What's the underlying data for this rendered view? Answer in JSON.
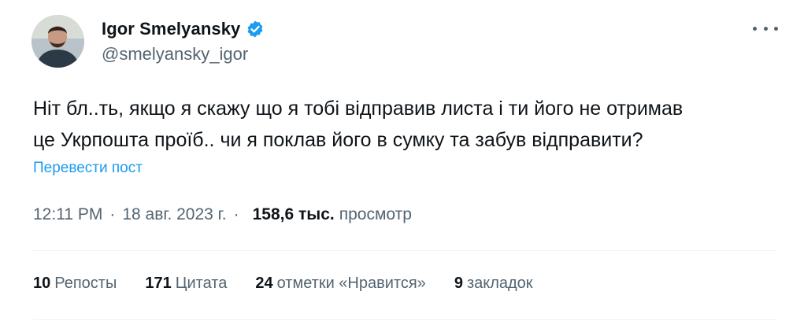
{
  "author": {
    "display_name": "Igor Smelyansky",
    "handle": "@smelyansky_igor",
    "verified": true
  },
  "icons": {
    "verified": "verified-badge-icon",
    "more": "more-options-icon"
  },
  "colors": {
    "link": "#1d9bf0",
    "secondary_text": "#536471",
    "verified_badge": "#1d9bf0"
  },
  "tweet": {
    "text": "Ніт бл..ть, якщо я скажу що я тобі відправив листа і ти його не отримав\nце Укрпошта проїб.. чи я поклав його в сумку та забув відправити?",
    "translate_label": "Перевести пост",
    "time": "12:11 PM",
    "date": "18 авг. 2023 г.",
    "views_count": "158,6 тыс.",
    "views_label": "просмотр"
  },
  "stats": {
    "reposts_count": "10",
    "reposts_label": "Репосты",
    "quotes_count": "171",
    "quotes_label": "Цитата",
    "likes_count": "24",
    "likes_label": "отметки «Нравится»",
    "bookmarks_count": "9",
    "bookmarks_label": "закладок"
  }
}
